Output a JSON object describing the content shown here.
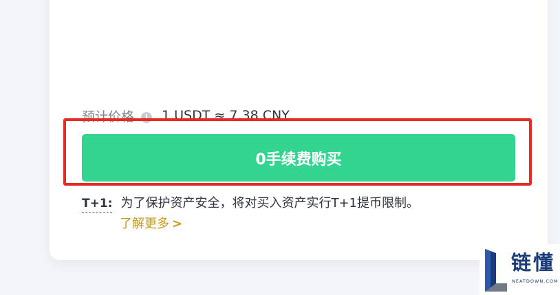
{
  "price": {
    "label": "预计价格",
    "info_icon": "info-icon",
    "value": "1 USDT ≈ 7.38 CNY"
  },
  "buy_button": {
    "label": "0手续费购买",
    "color": "#33d48f"
  },
  "notice": {
    "label": "T+1:",
    "text": "为了保护资产安全，将对买入资产实行T+1提币限制。",
    "learn_more": "了解更多",
    "learn_more_icon": "chevron-right-icon",
    "link_color": "#c99a1a"
  },
  "highlight": {
    "color": "#e52b25"
  },
  "watermark": {
    "title": "链懂",
    "subtitle": "NEATDOWN.COM",
    "logo_icon": "l-logo-icon"
  }
}
